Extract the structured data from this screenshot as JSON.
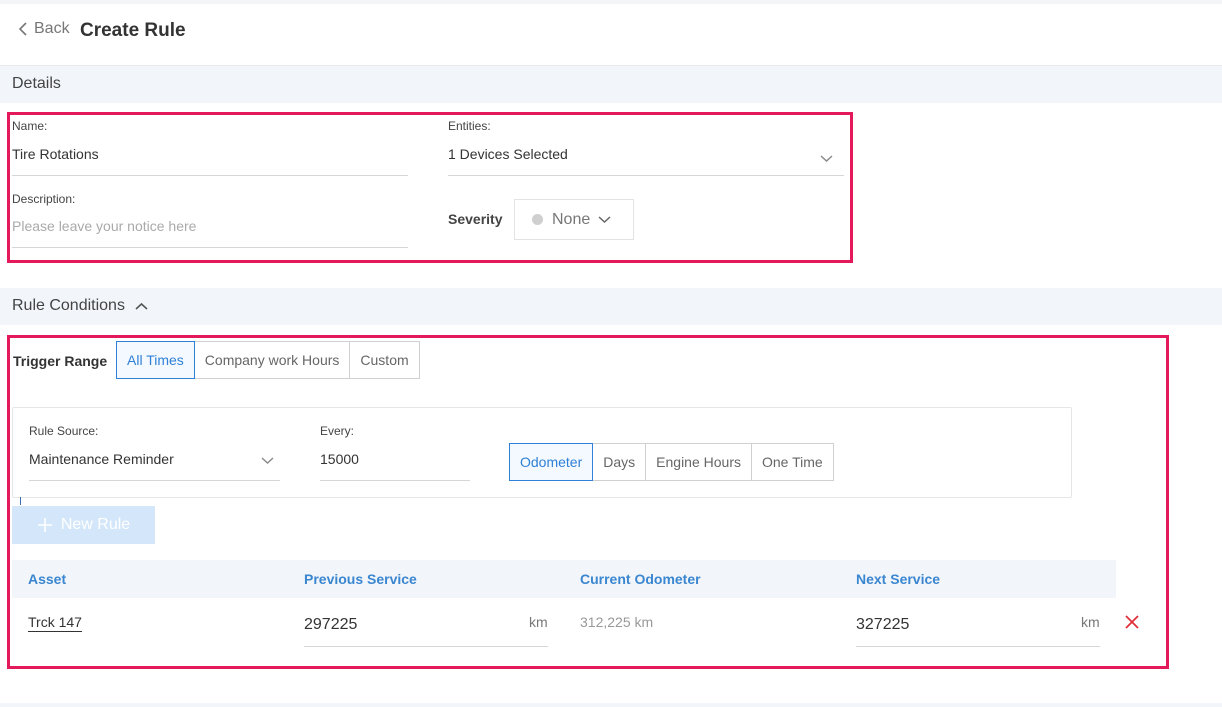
{
  "header": {
    "back_label": "Back",
    "title": "Create Rule"
  },
  "details": {
    "section_title": "Details",
    "name_label": "Name:",
    "name_value": "Tire Rotations",
    "entities_label": "Entities:",
    "entities_value": "1 Devices Selected",
    "description_label": "Description:",
    "description_placeholder": "Please leave your notice here",
    "severity_label": "Severity",
    "severity_value": "None"
  },
  "rule_conditions": {
    "section_title": "Rule Conditions",
    "trigger_range_label": "Trigger Range",
    "trigger_options": [
      {
        "label": "All Times",
        "active": true
      },
      {
        "label": "Company work Hours",
        "active": false
      },
      {
        "label": "Custom",
        "active": false
      }
    ],
    "rule_source_label": "Rule Source:",
    "rule_source_value": "Maintenance Reminder",
    "every_label": "Every:",
    "every_value": "15000",
    "unit_options": [
      {
        "label": "Odometer",
        "active": true
      },
      {
        "label": "Days",
        "active": false
      },
      {
        "label": "Engine Hours",
        "active": false
      },
      {
        "label": "One Time",
        "active": false
      }
    ],
    "new_rule_label": "New Rule"
  },
  "table": {
    "columns": [
      "Asset",
      "Previous Service",
      "Current Odometer",
      "Next Service"
    ],
    "rows": [
      {
        "asset": "Trck 147",
        "previous_service": "297225",
        "previous_unit": "km",
        "current_odometer": "312,225 km",
        "next_service": "327225",
        "next_unit": "km"
      }
    ]
  },
  "colors": {
    "accent": "#2f80d6",
    "highlight": "#e3195b",
    "remove": "#e0303a"
  }
}
